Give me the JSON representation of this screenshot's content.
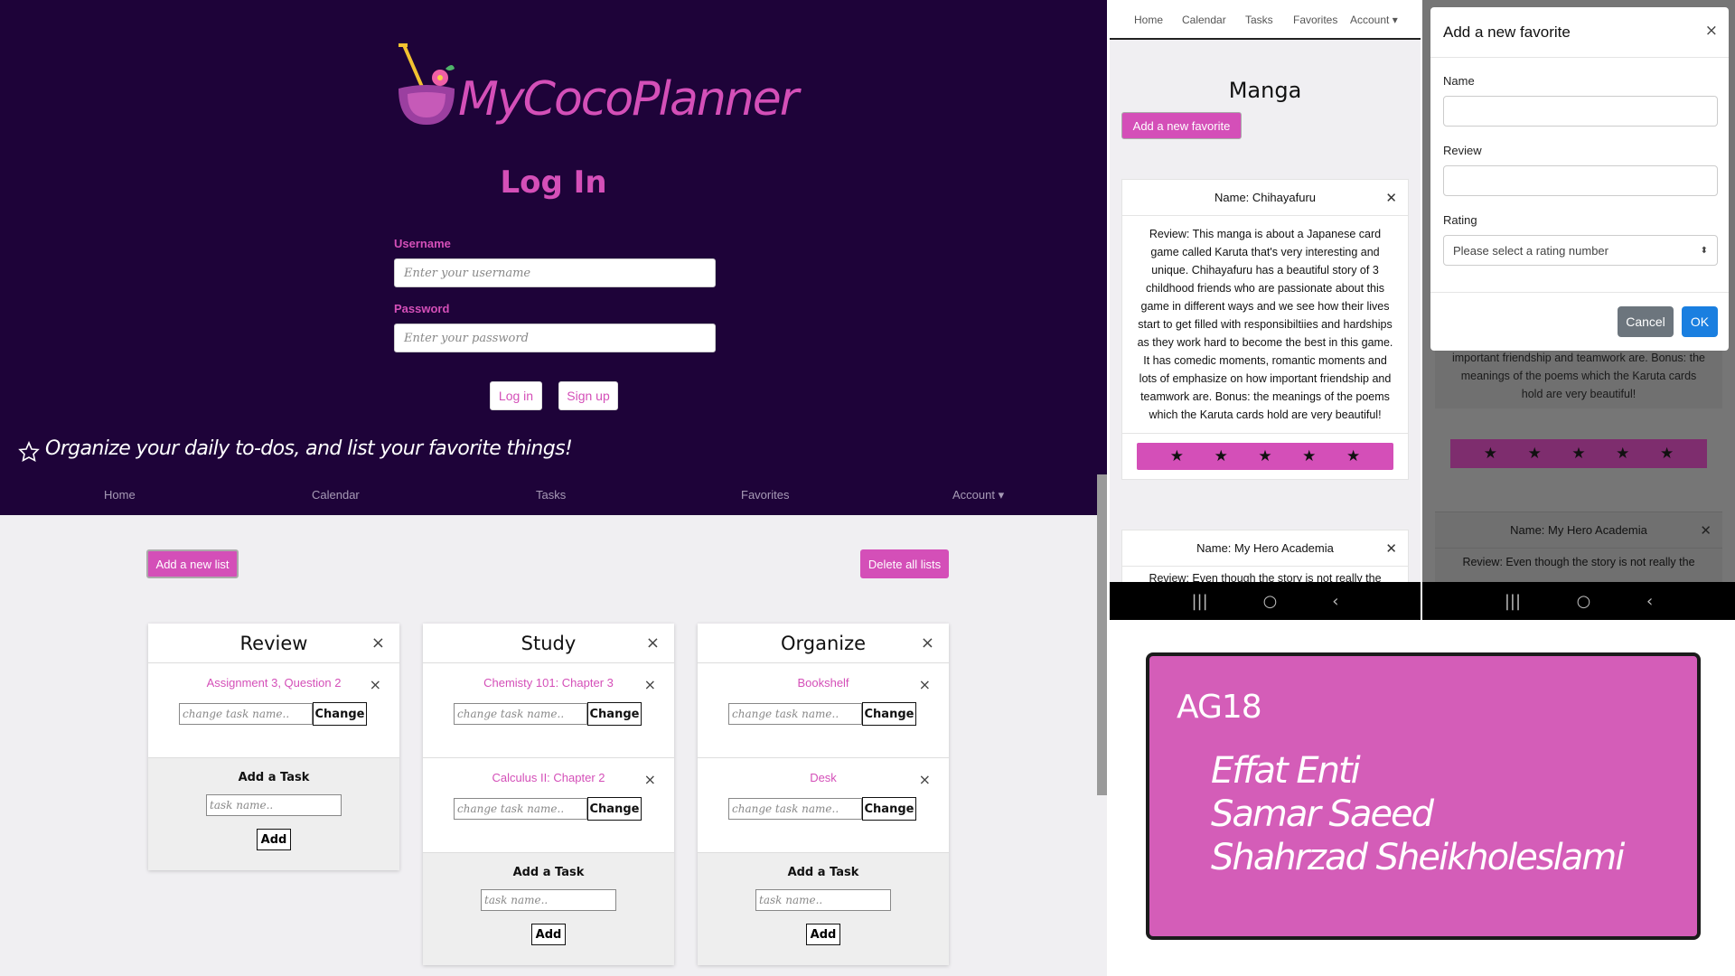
{
  "login": {
    "logo_text": "MyCocoPlanner",
    "title": "Log In",
    "username_label": "Username",
    "username_placeholder": "Enter your username",
    "password_label": "Password",
    "password_placeholder": "Enter your password",
    "login_button": "Log in",
    "signup_button": "Sign up",
    "tagline": "Organize your daily to-dos, and list your favorite things!",
    "nav": [
      "Home",
      "Calendar",
      "Tasks",
      "Favorites",
      "Account ▾"
    ]
  },
  "lists_page": {
    "add_list_button": "Add a new list",
    "delete_all_button": "Delete all lists",
    "change_placeholder": "change task name..",
    "change_button": "Change",
    "add_task_title": "Add a Task",
    "add_task_placeholder": "task name..",
    "add_button": "Add",
    "lists": [
      {
        "title": "Review",
        "tasks": [
          "Assignment 3, Question 2"
        ]
      },
      {
        "title": "Study",
        "tasks": [
          "Chemisty 101: Chapter 3",
          "Calculus II: Chapter 2"
        ]
      },
      {
        "title": "Organize",
        "tasks": [
          "Bookshelf",
          "Desk"
        ]
      }
    ]
  },
  "favorites_page": {
    "nav": [
      "Home",
      "Calendar",
      "Tasks",
      "Favorites",
      "Account ▾"
    ],
    "title": "Manga",
    "add_favorite_button": "Add a new favorite",
    "card1_name": "Name: Chihayafuru",
    "card1_review": "Review: This manga is about a Japanese card game called Karuta that's very interesting and unique. Chihayafuru has a beautiful story of 3 childhood friends who are passionate about this game in different ways and we see how their lives start to get filled with responsibiltiies and hardships as they work hard to become the best in this game. It has comedic moments, romantic moments and lots of emphasize on how important friendship and teamwork are. Bonus: the meanings of the poems which the Karuta cards hold are very beautiful!",
    "card1_rating": 5,
    "card2_name": "Name: My Hero Academia",
    "card2_review_partial": "Review: Even though the story is not really the",
    "behind_review_partial": "romantic moments and lots of emphasize on how important friendship and teamwork are. Bonus: the meanings of the poems which the Karuta cards hold are very beautiful!"
  },
  "modal": {
    "title": "Add a new favorite",
    "name_label": "Name",
    "review_label": "Review",
    "rating_label": "Rating",
    "rating_placeholder": "Please select a rating number",
    "cancel_button": "Cancel",
    "ok_button": "OK"
  },
  "group": {
    "code": "AG18",
    "members": [
      "Effat Enti",
      "Samar Saeed",
      "Shahrzad Sheikholeslami"
    ]
  },
  "colors": {
    "accent": "#d44fb8",
    "dark_bg": "#1e0339",
    "ok_blue": "#1a7fe0",
    "cancel_gray": "#6c757d"
  }
}
